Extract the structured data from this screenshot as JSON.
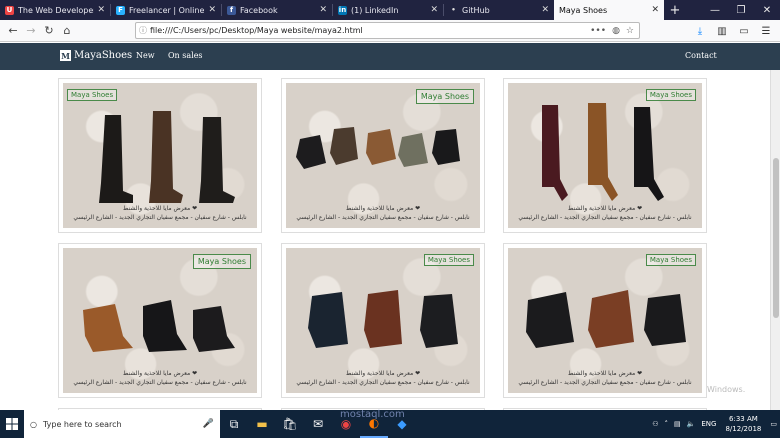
{
  "tabs": [
    {
      "title": "The Web Developer Boot",
      "icon": "udemy-icon",
      "color": "#e44"
    },
    {
      "title": "Freelancer | Online Jobs",
      "icon": "freelancer-icon",
      "color": "#29b2fe"
    },
    {
      "title": "Facebook",
      "icon": "facebook-icon",
      "color": "#3b5998"
    },
    {
      "title": "(1) LinkedIn",
      "icon": "linkedin-icon",
      "color": "#0077b5"
    },
    {
      "title": "GitHub",
      "icon": "github-icon",
      "color": "#333"
    },
    {
      "title": "Maya Shoes",
      "icon": "page-icon",
      "color": "#888"
    }
  ],
  "url": "file:///C:/Users/pc/Desktop/Maya website/maya2.html",
  "site": {
    "brand": "MayaShoes",
    "nav": [
      "New",
      "On sales"
    ],
    "contact": "Contact"
  },
  "products": [
    {
      "stamp": "Maya Shoes",
      "caption1": "❤ معرض مايا للاحذية والشنط",
      "caption2": "نابلس - شارع سفيان - مجمع سفيان التجاري الجديد - الشارع الرئيسي"
    },
    {
      "stamp": "Maya Shoes",
      "caption1": "❤ معرض مايا للاحذية والشنط",
      "caption2": "نابلس - شارع سفيان - مجمع سفيان التجاري الجديد - الشارع الرئيسي"
    },
    {
      "stamp": "Maya Shoes",
      "caption1": "❤ معرض مايا للاحذية والشنط",
      "caption2": "نابلس - شارع سفيان - مجمع سفيان التجاري الجديد - الشارع الرئيسي"
    },
    {
      "stamp": "Maya Shoes",
      "caption1": "❤ معرض مايا للاحذية والشنط",
      "caption2": "نابلس - شارع سفيان - مجمع سفيان التجاري الجديد - الشارع الرئيسي"
    },
    {
      "stamp": "Maya Shoes",
      "caption1": "❤ معرض مايا للاحذية والشنط",
      "caption2": "نابلس - شارع سفيان - مجمع سفيان التجاري الجديد - الشارع الرئيسي"
    },
    {
      "stamp": "Maya Shoes",
      "caption1": "❤ معرض مايا للاحذية والشنط",
      "caption2": "نابلس - شارع سفيان - مجمع سفيان التجاري الجديد - الشارع الرئيسي"
    }
  ],
  "watermark": "Windows.",
  "overlay_watermark": "mostaql.com",
  "taskbar": {
    "search_placeholder": "Type here to search",
    "language": "ENG",
    "time": "6:33 AM",
    "date": "8/12/2018"
  }
}
